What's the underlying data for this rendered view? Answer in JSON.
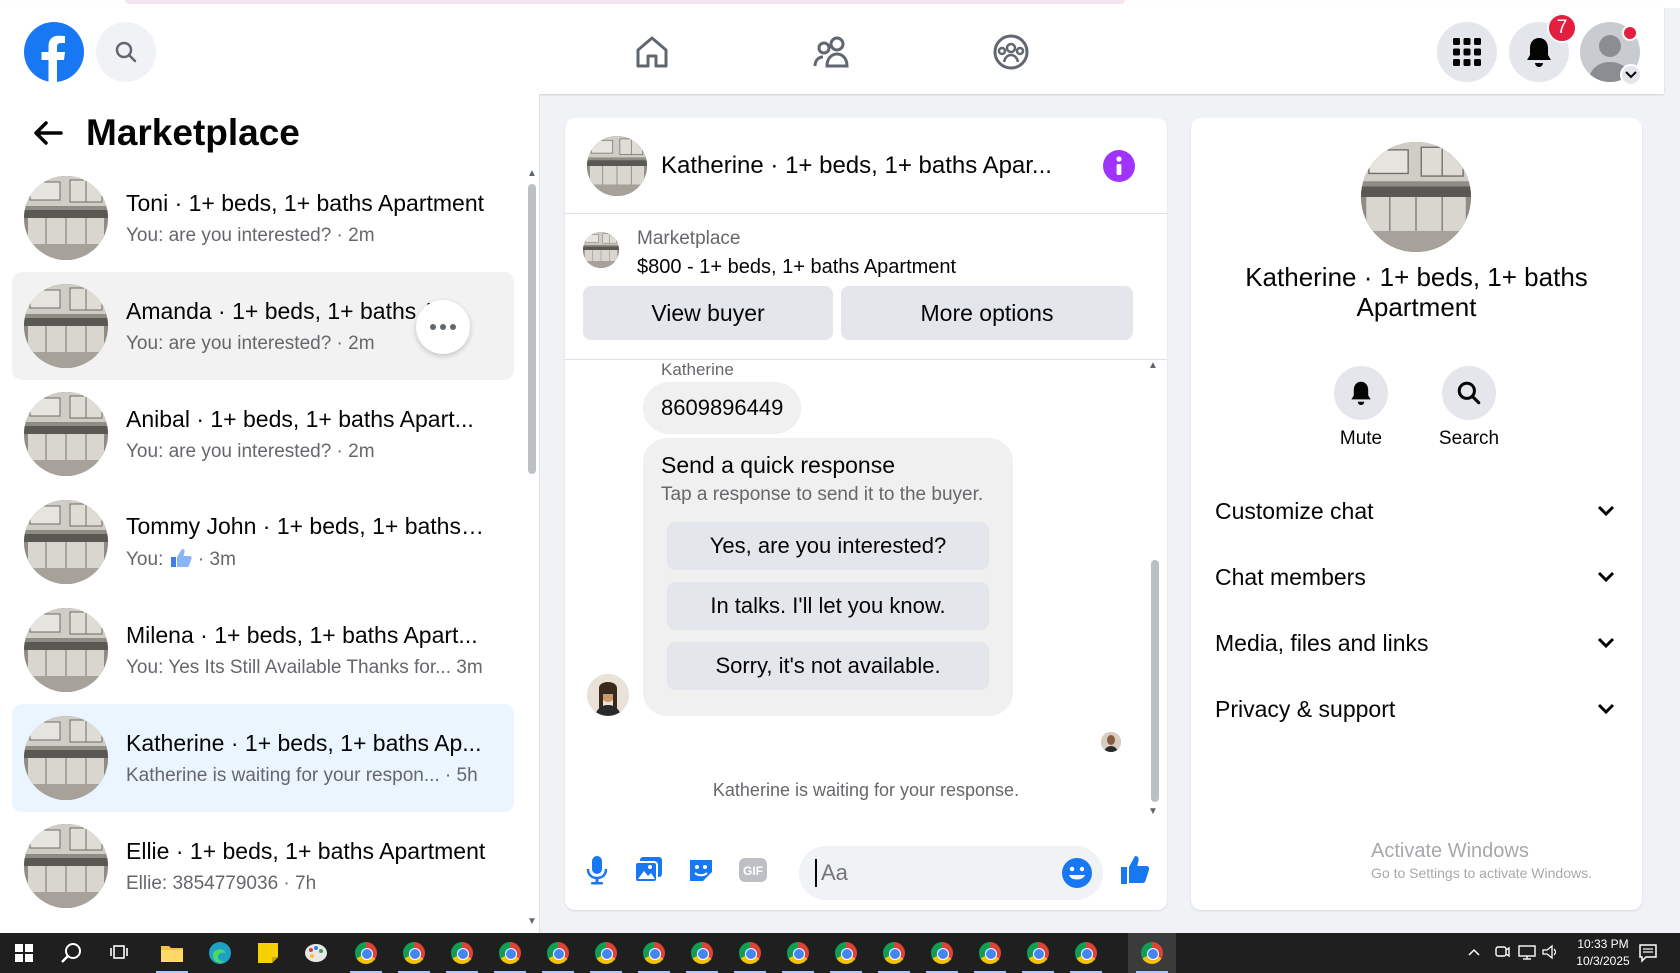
{
  "header": {
    "notification_count": "7"
  },
  "left_panel": {
    "title": "Marketplace",
    "conversations": [
      {
        "name": "Toni · 1+ beds, 1+ baths Apartment",
        "preview": "You: are you interested? · 2m"
      },
      {
        "name": "Amanda · 1+ beds, 1+ baths A...",
        "preview": "You: are you interested? · 2m"
      },
      {
        "name": "Anibal · 1+ beds, 1+ baths Apart...",
        "preview": "You: are you interested? · 2m"
      },
      {
        "name": "Tommy John · 1+ beds, 1+ baths ...",
        "preview_prefix": "You:",
        "preview_suffix": "· 3m"
      },
      {
        "name": "Milena · 1+ beds, 1+ baths Apart...",
        "preview": "You: Yes Its Still Available Thanks for... 3m"
      },
      {
        "name": "Katherine · 1+ beds, 1+ baths Ap...",
        "preview": "Katherine is waiting for your respon... · 5h"
      },
      {
        "name": "Ellie · 1+ beds, 1+ baths Apartment",
        "preview": "Ellie: 3854779036 · 7h"
      }
    ]
  },
  "chat": {
    "title": "Katherine · 1+ beds, 1+ baths Apar...",
    "listing_label": "Marketplace",
    "listing_price": "$800 - 1+ beds, 1+ baths Apartment",
    "view_buyer": "View buyer",
    "more_options": "More options",
    "sender": "Katherine",
    "message": "8609896449",
    "quick_title": "Send a quick response",
    "quick_sub": "Tap a response to send it to the buyer.",
    "quick_options": [
      "Yes, are you interested?",
      "In talks. I'll let you know.",
      "Sorry, it's not available."
    ],
    "waiting": "Katherine is waiting for your response.",
    "input_placeholder": "Aa"
  },
  "right_panel": {
    "name": "Katherine · 1+ beds, 1+ baths Apartment",
    "mute": "Mute",
    "search": "Search",
    "sections": [
      "Customize chat",
      "Chat members",
      "Media, files and links",
      "Privacy & support"
    ],
    "watermark_title": "Activate Windows",
    "watermark_sub": "Go to Settings to activate Windows."
  },
  "taskbar": {
    "time": "10:33 PM",
    "date": "10/3/2025"
  },
  "colors": {
    "facebook_blue": "#1877f2",
    "badge_red": "#e41e3f",
    "info_purple": "#a033ff",
    "active_row": "#ebf5ff"
  }
}
